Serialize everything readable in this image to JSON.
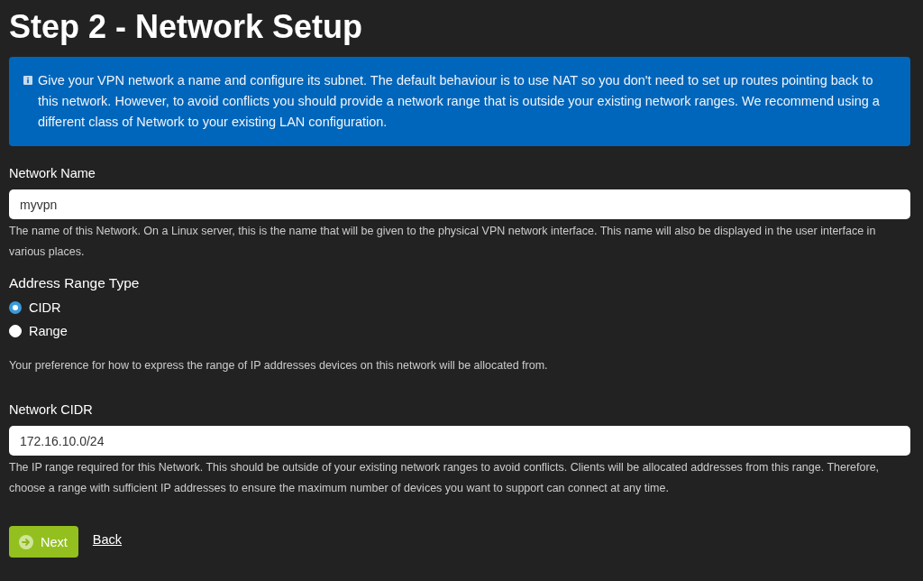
{
  "page": {
    "title": "Step 2 - Network Setup"
  },
  "info_box": {
    "text": "Give your VPN network a name and configure its subnet. The default behaviour is to use NAT so you don't need to set up routes pointing back to this network. However, to avoid conflicts you should provide a network range that is outside your existing network ranges. We recommend using a different class of Network to your existing LAN configuration."
  },
  "fields": [
    {
      "kind": "text",
      "label": "Network Name",
      "value": "myvpn",
      "help": "The name of this Network. On a Linux server, this is the name that will be given to the physical VPN network interface. This name will also be displayed in the user interface in various places."
    },
    {
      "kind": "radio",
      "label": "Address Range Type",
      "options": [
        {
          "label": "CIDR",
          "selected": true
        },
        {
          "label": "Range",
          "selected": false
        }
      ],
      "help": "Your preference for how to express the range of IP addresses devices on this network will be allocated from."
    },
    {
      "kind": "text",
      "label": "Network CIDR",
      "value": "172.16.10.0/24",
      "help": "The IP range required for this Network. This should be outside of your existing network ranges to avoid conflicts. Clients will be allocated addresses from this range. Therefore, choose a range with sufficient IP addresses to ensure the maximum number of devices you want to support can connect at any time."
    }
  ],
  "buttons": [
    {
      "kind": "primary",
      "label": "Next"
    },
    {
      "kind": "link",
      "label": "Back"
    }
  ]
}
